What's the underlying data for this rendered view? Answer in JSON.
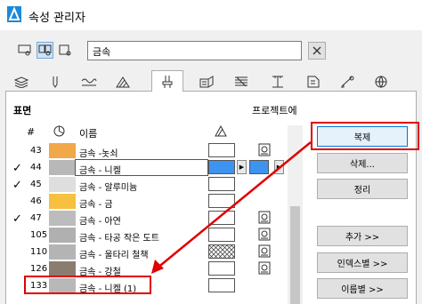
{
  "window": {
    "title": "속성 관리자"
  },
  "search": {
    "value": "금속"
  },
  "surface_label": "표면",
  "project_label": "프로젝트에",
  "header": {
    "num": "#",
    "name": "이름"
  },
  "rows": [
    {
      "num": "43",
      "name": "금속 -놋쇠",
      "color": "#f0a848",
      "checked": false,
      "in_project": true,
      "selected": false
    },
    {
      "num": "44",
      "name": "금속 - 니켈",
      "color": "#b8b8b8",
      "checked": true,
      "in_project": false,
      "selected": true
    },
    {
      "num": "45",
      "name": "금속 - 알루미늄",
      "color": "#dedede",
      "checked": true,
      "in_project": false,
      "selected": false
    },
    {
      "num": "46",
      "name": "금속 - 금",
      "color": "#f8c040",
      "checked": false,
      "in_project": false,
      "selected": false
    },
    {
      "num": "47",
      "name": "금속 - 아연",
      "color": "#bcbcbc",
      "checked": true,
      "in_project": true,
      "selected": false
    },
    {
      "num": "105",
      "name": "금속 - 타공 작은 도트",
      "color": "#b0b0b0",
      "checked": false,
      "in_project": true,
      "selected": false
    },
    {
      "num": "110",
      "name": "금속 - 울타리 철책",
      "color": "#b4b4b4",
      "checked": false,
      "in_project": true,
      "selected": false
    },
    {
      "num": "126",
      "name": "금속 - 강철",
      "color": "#8a7d70",
      "checked": false,
      "in_project": true,
      "selected": false
    },
    {
      "num": "133",
      "name": "금속 - 니켈 (1)",
      "color": "#b8b8b8",
      "checked": false,
      "in_project": false,
      "selected": false
    }
  ],
  "buttons": {
    "duplicate": "복제",
    "delete": "삭제...",
    "arrange": "정리",
    "add": "추가 >>",
    "by_index": "인덱스별 >>",
    "by_name": "이름별 >>"
  }
}
